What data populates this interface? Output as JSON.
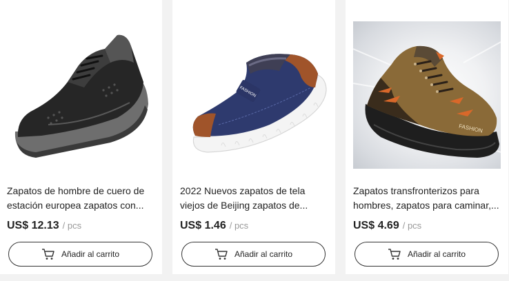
{
  "products": [
    {
      "title_line1": "Zapatos de hombre de cuero de",
      "title_line2": "estación europea zapatos con...",
      "price": "US$ 12.13",
      "unit": "/ pcs",
      "cart_label": "Añadir al carrito",
      "image_icon": "black-leather-sneaker"
    },
    {
      "title_line1": "2022 Nuevos zapatos de tela",
      "title_line2": "viejos de Beijing zapatos de...",
      "price": "US$ 1.46",
      "unit": "/ pcs",
      "cart_label": "Añadir al carrito",
      "image_icon": "navy-fleece-slip-on",
      "logo_text": "FASHION"
    },
    {
      "title_line1": "Zapatos transfronterizos para",
      "title_line2": "hombres, zapatos para caminar,...",
      "price": "US$ 4.69",
      "unit": "/ pcs",
      "cart_label": "Añadir al carrito",
      "image_icon": "brown-hiking-shoe",
      "logo_text": "FASHION"
    }
  ],
  "colors": {
    "page_bg": "#f2f2f2",
    "card_bg": "#ffffff",
    "text": "#222222",
    "muted": "#999999",
    "button_border": "#333333"
  }
}
